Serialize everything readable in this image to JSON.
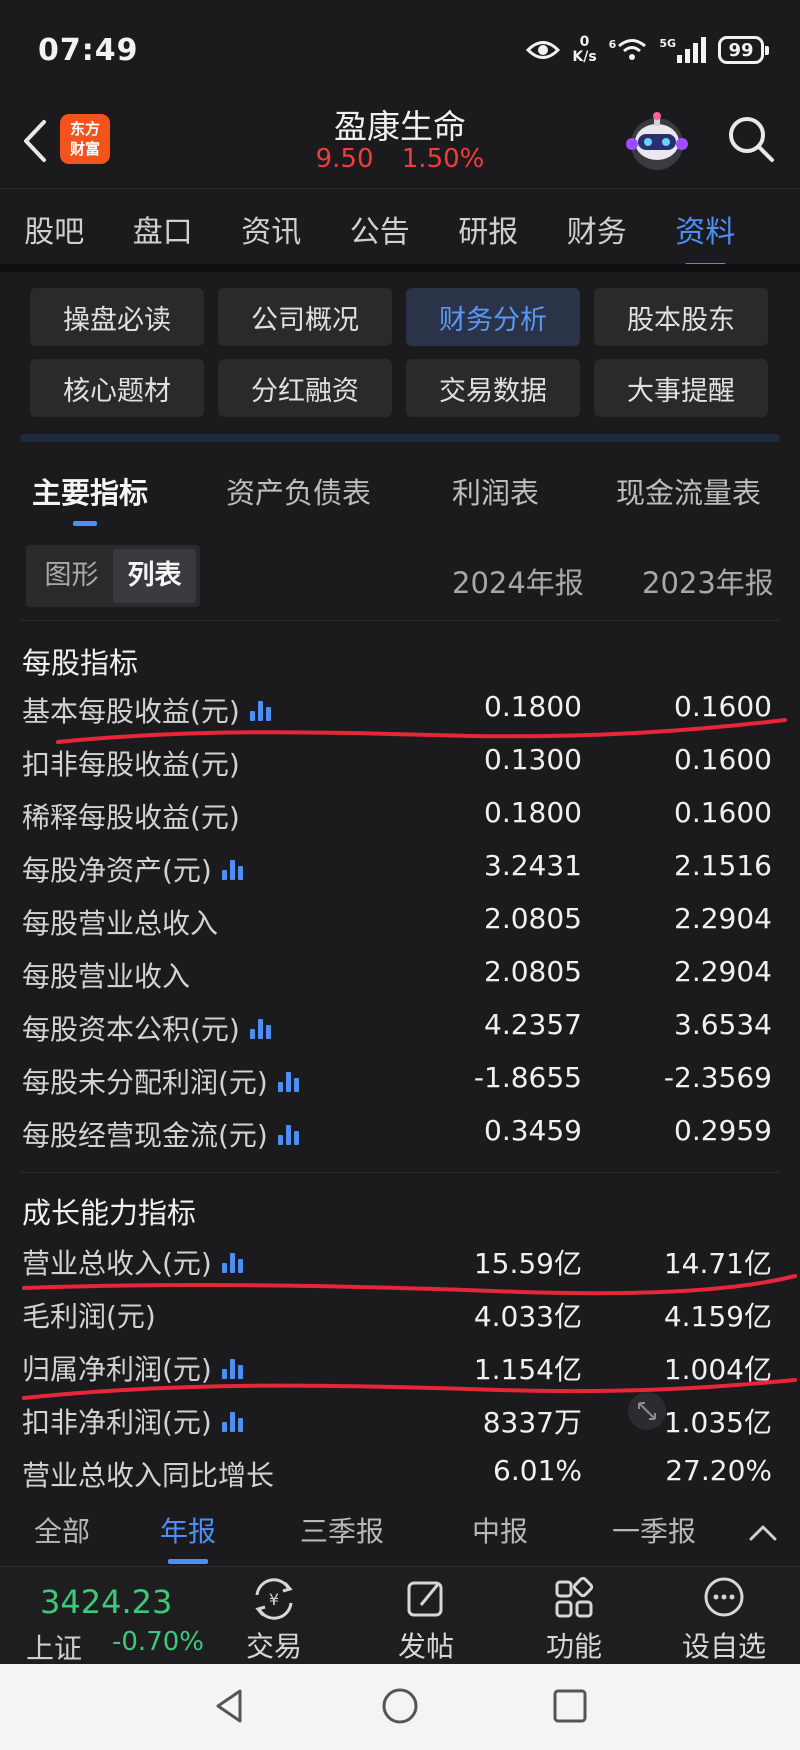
{
  "status_bar": {
    "time": "07:49",
    "net_speed_value": "0",
    "net_speed_unit": "K/s",
    "signal_label": "5G",
    "wifi_label": "6",
    "battery": "99"
  },
  "header": {
    "brand_line1": "东方",
    "brand_line2": "财富",
    "title": "盈康生命",
    "price": "9.50",
    "change_pct": "1.50%"
  },
  "main_tabs": [
    "股吧",
    "盘口",
    "资讯",
    "公告",
    "研报",
    "财务",
    "资料"
  ],
  "sub_menu": [
    "操盘必读",
    "公司概况",
    "财务分析",
    "股本股东",
    "核心题材",
    "分红融资",
    "交易数据",
    "大事提醒"
  ],
  "fin_tabs": [
    "主要指标",
    "资产负债表",
    "利润表",
    "现金流量表"
  ],
  "view_toggle": {
    "graph": "图形",
    "list": "列表"
  },
  "periods": {
    "col1": "2024年报",
    "col2": "2023年报"
  },
  "groups": [
    {
      "title": "每股指标",
      "rows": [
        {
          "label": "基本每股收益(元)",
          "v1": "0.1800",
          "v2": "0.1600"
        },
        {
          "label": "扣非每股收益(元)",
          "v1": "0.1300",
          "v2": "0.1600"
        },
        {
          "label": "稀释每股收益(元)",
          "v1": "0.1800",
          "v2": "0.1600"
        },
        {
          "label": "每股净资产(元)",
          "v1": "3.2431",
          "v2": "2.1516"
        },
        {
          "label": "每股营业总收入",
          "v1": "2.0805",
          "v2": "2.2904"
        },
        {
          "label": "每股营业收入",
          "v1": "2.0805",
          "v2": "2.2904"
        },
        {
          "label": "每股资本公积(元)",
          "v1": "4.2357",
          "v2": "3.6534"
        },
        {
          "label": "每股未分配利润(元)",
          "v1": "-1.8655",
          "v2": "-2.3569"
        },
        {
          "label": "每股经营现金流(元)",
          "v1": "0.3459",
          "v2": "0.2959"
        }
      ]
    },
    {
      "title": "成长能力指标",
      "rows": [
        {
          "label": "营业总收入(元)",
          "v1": "15.59亿",
          "v2": "14.71亿"
        },
        {
          "label": "毛利润(元)",
          "v1": "4.033亿",
          "v2": "4.159亿"
        },
        {
          "label": "归属净利润(元)",
          "v1": "1.154亿",
          "v2": "1.004亿"
        },
        {
          "label": "扣非净利润(元)",
          "v1": "8337万",
          "v2": "1.035亿"
        },
        {
          "label": "营业总收入同比增长",
          "v1": "6.01%",
          "v2": "27.20%"
        }
      ]
    }
  ],
  "period_tabs": [
    "全部",
    "年报",
    "三季报",
    "中报",
    "一季报"
  ],
  "bottom_bar": {
    "index_value": "3424.23",
    "index_name": "上证",
    "index_change": "-0.70%",
    "nav": [
      "交易",
      "发帖",
      "功能",
      "设自选"
    ]
  },
  "colors": {
    "accent": "#4d8ff5",
    "up": "#f23c3c",
    "down": "#3cc97a",
    "annotation": "#e8263a"
  }
}
